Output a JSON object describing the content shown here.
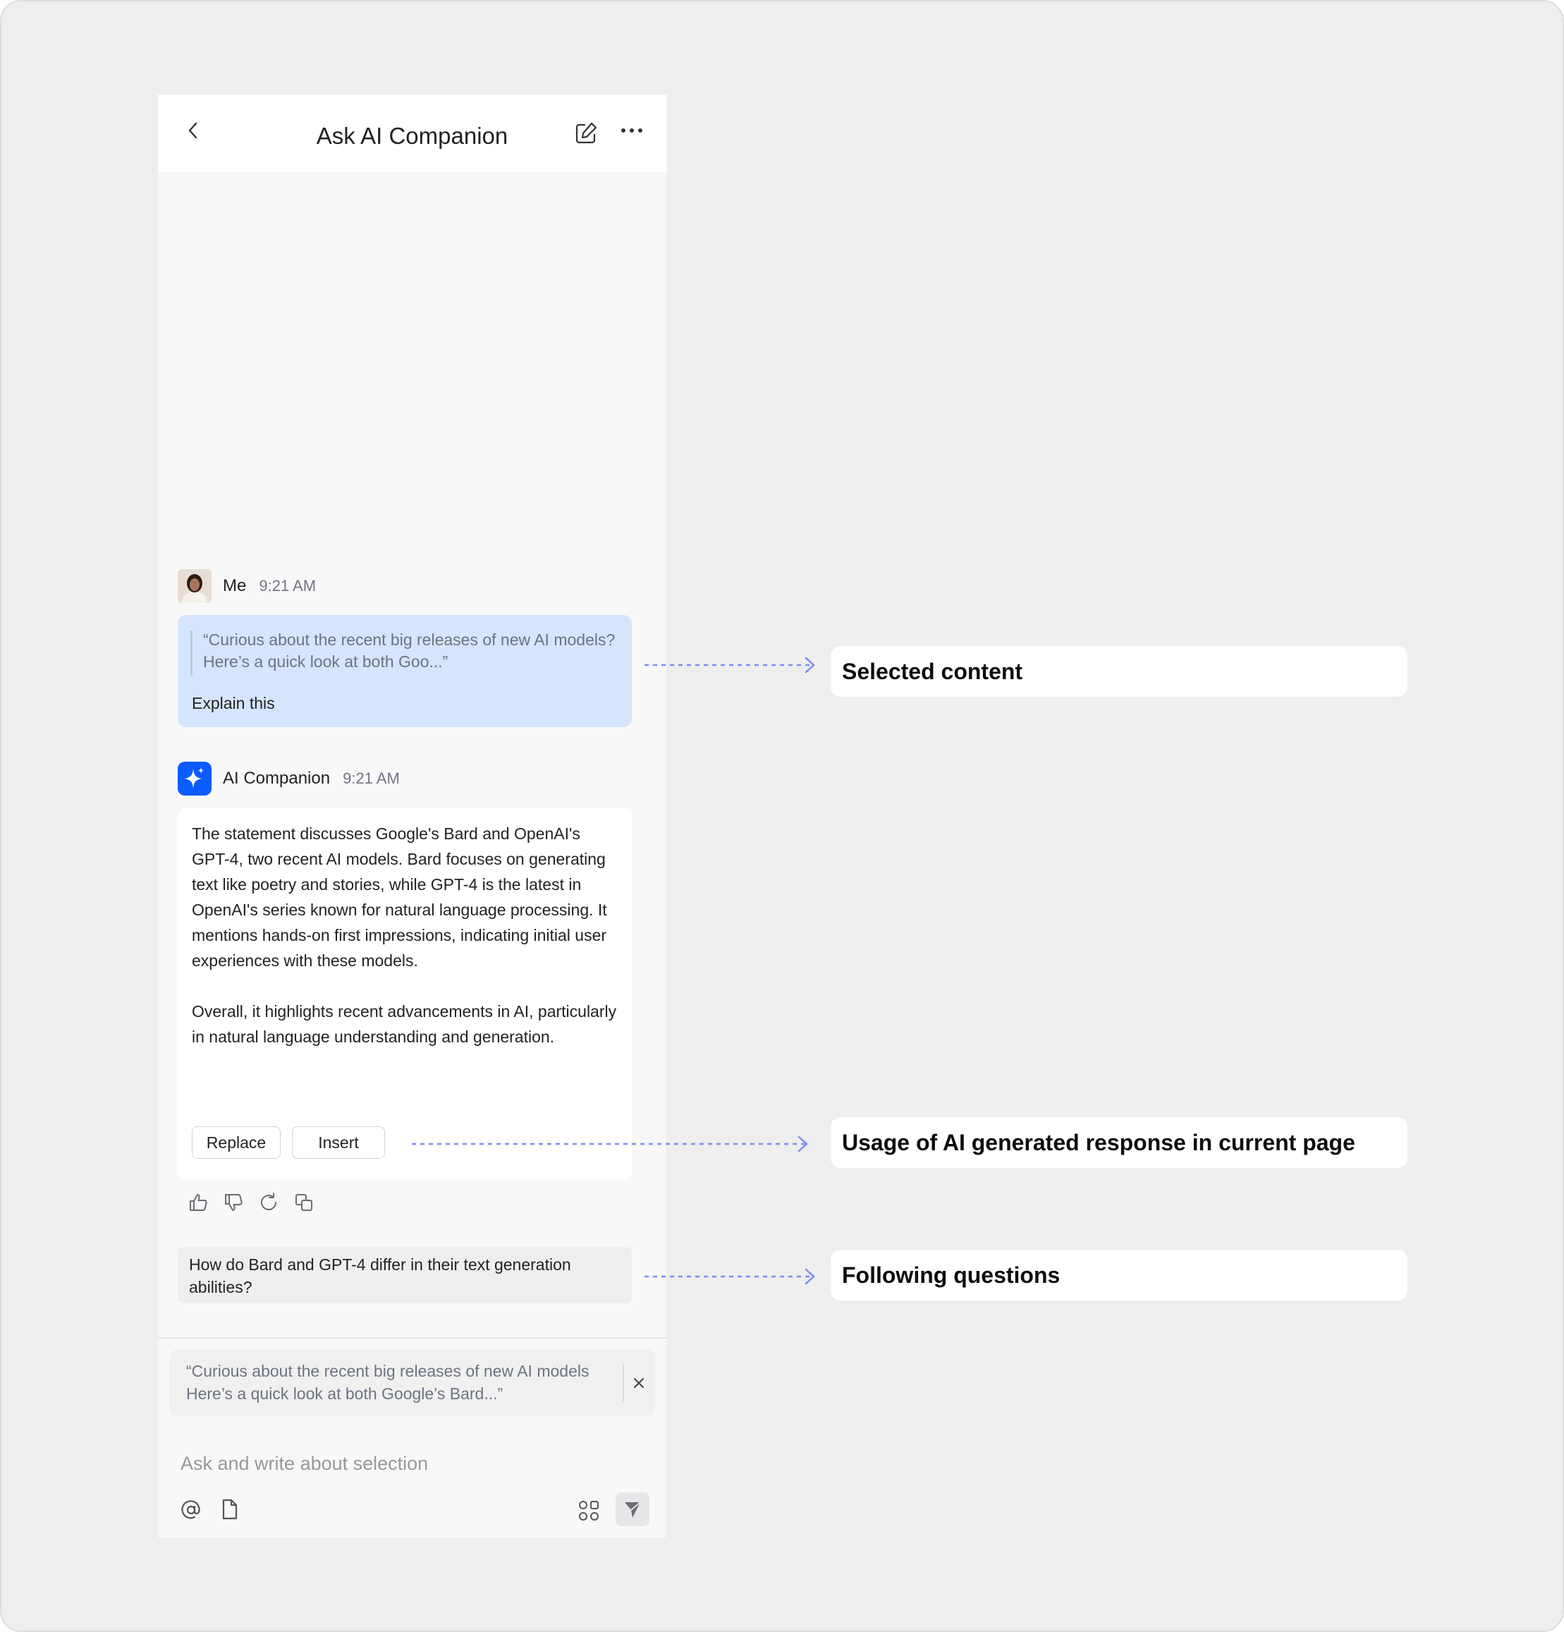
{
  "header": {
    "title": "Ask AI Companion"
  },
  "user_message": {
    "sender": "Me",
    "time": "9:21 AM",
    "quote": "“Curious about the recent big releases of new AI models? Here’s a quick look at both Goo...”",
    "prompt": "Explain this"
  },
  "ai_message": {
    "sender": "AI Companion",
    "time": "9:21 AM",
    "paragraph_1": "The statement discusses Google's Bard and OpenAI's GPT-4, two recent AI models. Bard focuses on generating text like poetry and stories, while GPT-4 is the latest in OpenAI's series known for natural language processing. It mentions hands-on first impressions, indicating initial user experiences with these models.",
    "paragraph_2": "Overall, it highlights recent advancements in AI, particularly in natural language understanding and generation.",
    "replace_label": "Replace",
    "insert_label": "Insert"
  },
  "suggested_question": "How do Bard and GPT-4 differ in their text generation abilities?",
  "composer": {
    "selection": "“Curious about the recent big releases of new AI models Here’s a quick look at both Google’s Bard...”",
    "placeholder": "Ask and write about selection"
  },
  "annotations": {
    "selected_content": "Selected content",
    "usage": "Usage of AI generated response in current page",
    "following_questions": "Following questions"
  },
  "colors": {
    "accent": "#0b5cff",
    "user_bubble": "#d6e4fd",
    "connector": "#7b8cf0"
  },
  "icons": [
    "back-icon",
    "new-chat-icon",
    "more-icon",
    "sparkle-icon",
    "thumbs-up-icon",
    "thumbs-down-icon",
    "regenerate-icon",
    "copy-icon",
    "close-icon",
    "mention-icon",
    "document-icon",
    "apps-icon",
    "send-icon"
  ]
}
